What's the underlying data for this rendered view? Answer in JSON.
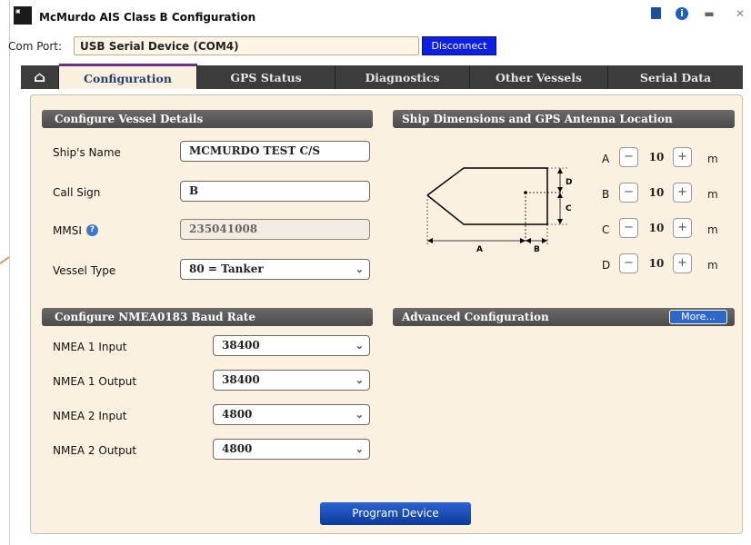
{
  "window": {
    "title": "McMurdo AIS Class B Configuration",
    "icons": [
      "app-logo-icon",
      "book-icon",
      "info-icon",
      "minimize-icon",
      "close-icon"
    ]
  },
  "com_port": {
    "label": "Com Port:",
    "value": "USB Serial Device (COM4)",
    "disconnect_label": "Disconnect"
  },
  "tabs": [
    {
      "label": "",
      "icon": "home-icon"
    },
    {
      "label": "Configuration",
      "active": true
    },
    {
      "label": "GPS Status"
    },
    {
      "label": "Diagnostics"
    },
    {
      "label": "Other Vessels"
    },
    {
      "label": "Serial Data"
    }
  ],
  "vessel": {
    "header": "Configure Vessel Details",
    "ship_name_label": "Ship's Name",
    "ship_name_value": "MCMURDO TEST C/S",
    "call_sign_label": "Call Sign",
    "call_sign_value": "B",
    "mmsi_label": "MMSI",
    "mmsi_value": "235041008",
    "vessel_type_label": "Vessel Type",
    "vessel_type_value": "80 = Tanker"
  },
  "dimensions": {
    "header": "Ship Dimensions and GPS Antenna Location",
    "diagram_labels": {
      "a": "A",
      "b": "B",
      "c": "C",
      "d": "D"
    },
    "rows": [
      {
        "label": "A",
        "value": "10",
        "unit": "m"
      },
      {
        "label": "B",
        "value": "10",
        "unit": "m"
      },
      {
        "label": "C",
        "value": "10",
        "unit": "m"
      },
      {
        "label": "D",
        "value": "10",
        "unit": "m"
      }
    ]
  },
  "baud": {
    "header": "Configure NMEA0183 Baud Rate",
    "rows": [
      {
        "label": "NMEA 1 Input",
        "value": "38400"
      },
      {
        "label": "NMEA 1 Output",
        "value": "38400"
      },
      {
        "label": "NMEA 2 Input",
        "value": "4800"
      },
      {
        "label": "NMEA 2 Output",
        "value": "4800"
      }
    ]
  },
  "advanced": {
    "header": "Advanced Configuration",
    "more_label": "More..."
  },
  "program_label": "Program Device",
  "colors": {
    "accent_blue": "#0d1fe0",
    "tab_bar": "#3c3c3c",
    "panel_bg": "#faf1e0",
    "active_tab_border": "#6b2f8e",
    "annotation_arrow": "#e07a2a"
  }
}
